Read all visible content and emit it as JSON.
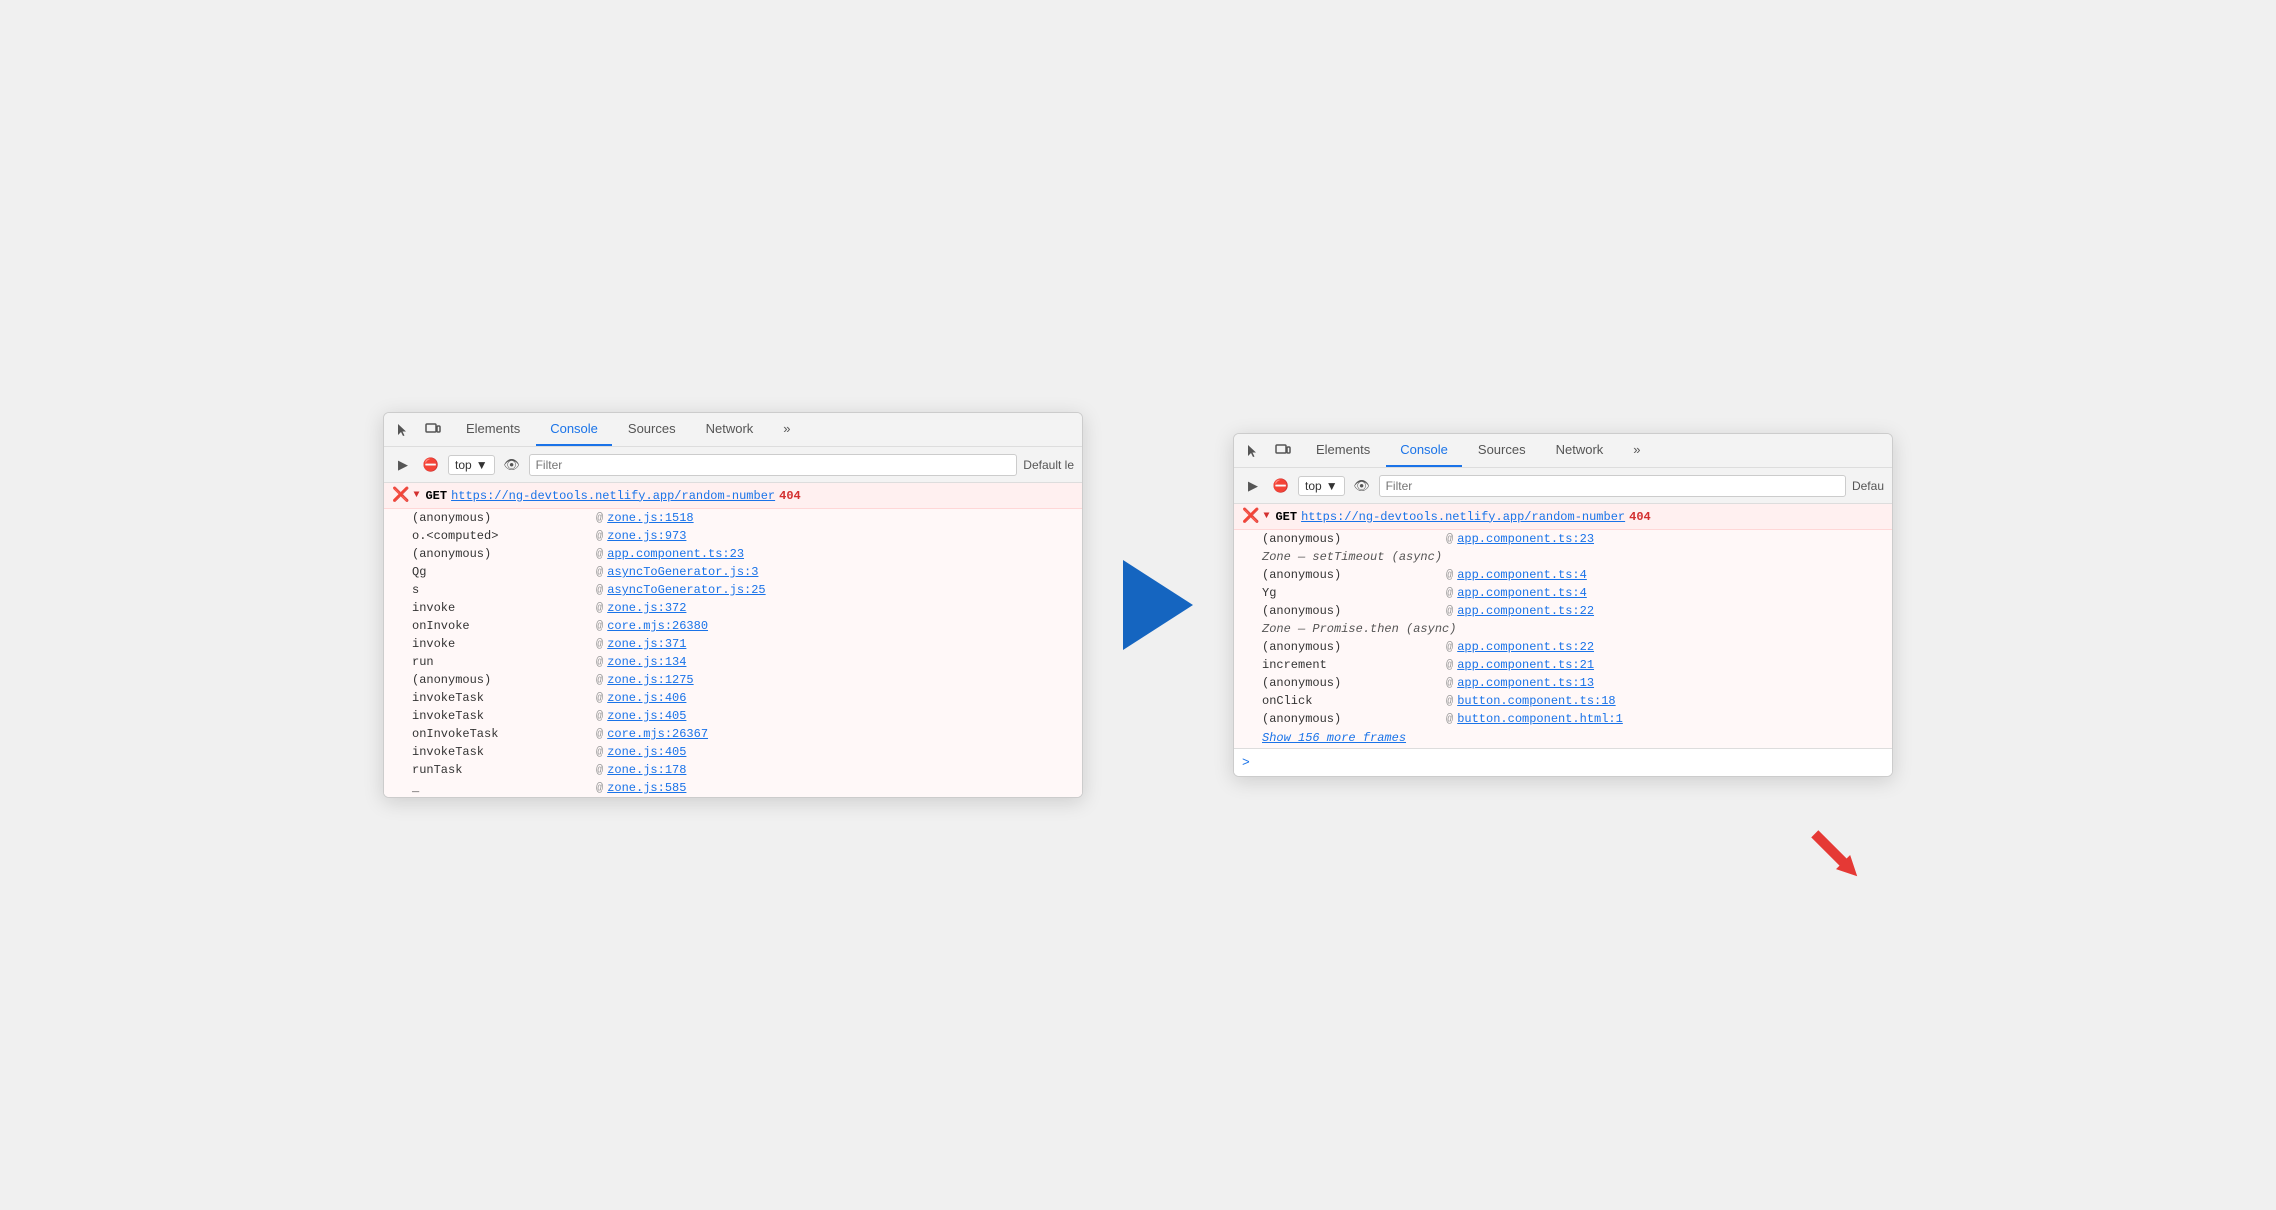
{
  "left_panel": {
    "tabs": [
      {
        "label": "Elements",
        "active": false
      },
      {
        "label": "Console",
        "active": true
      },
      {
        "label": "Sources",
        "active": false
      },
      {
        "label": "Network",
        "active": false
      },
      {
        "label": "»",
        "active": false
      }
    ],
    "console_toolbar": {
      "top_label": "top",
      "filter_placeholder": "Filter",
      "default_label": "Default le"
    },
    "error": {
      "method": "GET",
      "url": "https://ng-devtools.netlify.app/random-number",
      "code": "404"
    },
    "stack_frames": [
      {
        "fn": "(anonymous)",
        "at": "@",
        "link": "zone.js:1518"
      },
      {
        "fn": "o.<computed>",
        "at": "@",
        "link": "zone.js:973"
      },
      {
        "fn": "(anonymous)",
        "at": "@",
        "link": "app.component.ts:23"
      },
      {
        "fn": "Qg",
        "at": "@",
        "link": "asyncToGenerator.js:3"
      },
      {
        "fn": "s",
        "at": "@",
        "link": "asyncToGenerator.js:25"
      },
      {
        "fn": "invoke",
        "at": "@",
        "link": "zone.js:372"
      },
      {
        "fn": "onInvoke",
        "at": "@",
        "link": "core.mjs:26380"
      },
      {
        "fn": "invoke",
        "at": "@",
        "link": "zone.js:371"
      },
      {
        "fn": "run",
        "at": "@",
        "link": "zone.js:134"
      },
      {
        "fn": "(anonymous)",
        "at": "@",
        "link": "zone.js:1275"
      },
      {
        "fn": "invokeTask",
        "at": "@",
        "link": "zone.js:406"
      },
      {
        "fn": "invokeTask",
        "at": "@",
        "link": "zone.js:405"
      },
      {
        "fn": "onInvokeTask",
        "at": "@",
        "link": "core.mjs:26367"
      },
      {
        "fn": "invokeTask",
        "at": "@",
        "link": "zone.js:405"
      },
      {
        "fn": "runTask",
        "at": "@",
        "link": "zone.js:178"
      },
      {
        "fn": "_",
        "at": "@",
        "link": "zone.js:585"
      }
    ]
  },
  "right_panel": {
    "tabs": [
      {
        "label": "Elements",
        "active": false
      },
      {
        "label": "Console",
        "active": true
      },
      {
        "label": "Sources",
        "active": false
      },
      {
        "label": "Network",
        "active": false
      },
      {
        "label": "»",
        "active": false
      }
    ],
    "console_toolbar": {
      "top_label": "top",
      "filter_placeholder": "Filter",
      "default_label": "Defau"
    },
    "error": {
      "method": "GET",
      "url": "https://ng-devtools.netlify.app/random-number",
      "code": "404"
    },
    "stack_frames_before": [
      {
        "fn": "(anonymous)",
        "at": "@",
        "link": "app.component.ts:23"
      }
    ],
    "async1_label": "Zone — setTimeout (async)",
    "stack_frames_async1": [
      {
        "fn": "(anonymous)",
        "at": "@",
        "link": "app.component.ts:4"
      },
      {
        "fn": "Yg",
        "at": "@",
        "link": "app.component.ts:4"
      },
      {
        "fn": "(anonymous)",
        "at": "@",
        "link": "app.component.ts:22"
      }
    ],
    "async2_label": "Zone — Promise.then (async)",
    "stack_frames_async2": [
      {
        "fn": "(anonymous)",
        "at": "@",
        "link": "app.component.ts:22"
      },
      {
        "fn": "increment",
        "at": "@",
        "link": "app.component.ts:21"
      },
      {
        "fn": "(anonymous)",
        "at": "@",
        "link": "app.component.ts:13"
      },
      {
        "fn": "onClick",
        "at": "@",
        "link": "button.component.ts:18"
      },
      {
        "fn": "(anonymous)",
        "at": "@",
        "link": "button.component.html:1"
      }
    ],
    "show_more_label": "Show 156 more frames",
    "prompt_symbol": ">"
  }
}
